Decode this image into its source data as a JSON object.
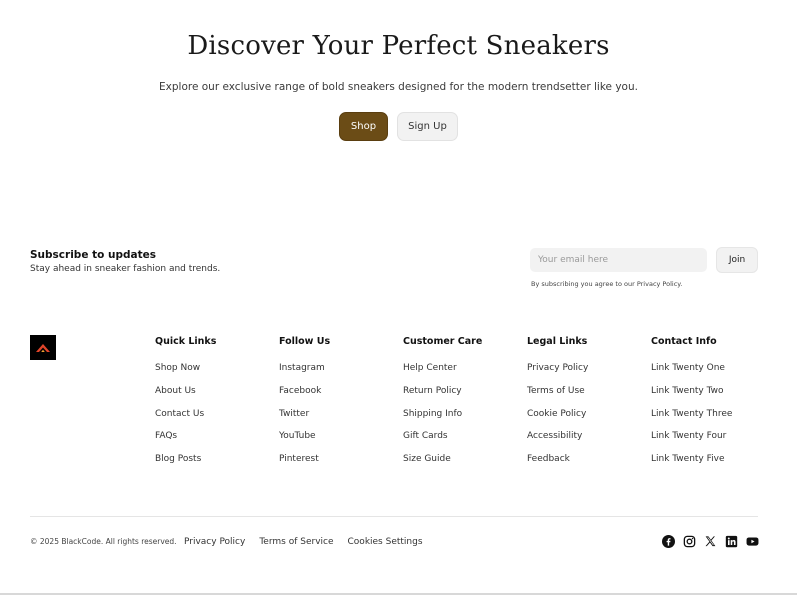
{
  "hero": {
    "title": "Discover Your Perfect Sneakers",
    "subtitle": "Explore our exclusive range of bold sneakers designed for the modern trendsetter like you.",
    "shop_label": "Shop",
    "signup_label": "Sign Up"
  },
  "subscribe": {
    "title": "Subscribe to updates",
    "description": "Stay ahead in sneaker fashion and trends.",
    "email_placeholder": "Your email here",
    "join_label": "Join",
    "consent": "By subscribing you agree to our Privacy Policy."
  },
  "footer": {
    "columns": [
      {
        "title": "Quick Links",
        "links": [
          "Shop Now",
          "About Us",
          "Contact Us",
          "FAQs",
          "Blog Posts"
        ]
      },
      {
        "title": "Follow Us",
        "links": [
          "Instagram",
          "Facebook",
          "Twitter",
          "YouTube",
          "Pinterest"
        ]
      },
      {
        "title": "Customer Care",
        "links": [
          "Help Center",
          "Return Policy",
          "Shipping Info",
          "Gift Cards",
          "Size Guide"
        ]
      },
      {
        "title": "Legal Links",
        "links": [
          "Privacy Policy",
          "Terms of Use",
          "Cookie Policy",
          "Accessibility",
          "Feedback"
        ]
      },
      {
        "title": "Contact Info",
        "links": [
          "Link Twenty One",
          "Link Twenty Two",
          "Link Twenty Three",
          "Link Twenty Four",
          "Link Twenty Five"
        ]
      }
    ],
    "copyright": "© 2025 BlackCode. All rights reserved.",
    "legal": [
      "Privacy Policy",
      "Terms of Service",
      "Cookies Settings"
    ],
    "socials": [
      "facebook-icon",
      "instagram-icon",
      "x-icon",
      "linkedin-icon",
      "youtube-icon"
    ]
  },
  "colors": {
    "accent": "#6b4c16",
    "logo_bg": "#000000",
    "logo_mark": "#e0442a"
  }
}
